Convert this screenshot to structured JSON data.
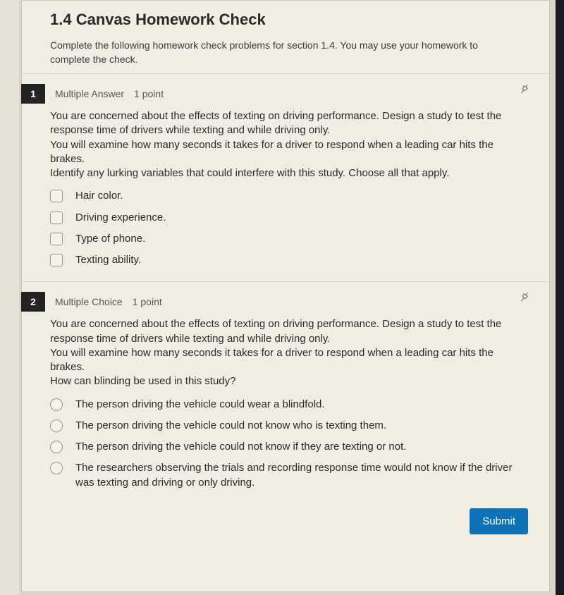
{
  "header": {
    "title": "1.4 Canvas Homework Check",
    "instructions": "Complete the following homework check problems for section 1.4. You may use your homework to complete the check."
  },
  "questions": [
    {
      "number": "1",
      "type": "Multiple Answer",
      "points": "1 point",
      "prompt": "You are concerned about the effects of texting on driving performance. Design a study to test the response time of drivers while texting and while driving only.\nYou will examine how many seconds it takes for a driver to respond when a leading car hits the brakes.\nIdentify any lurking variables that could interfere with this study.  Choose all that apply.",
      "control": "checkbox",
      "options": [
        "Hair color.",
        "Driving experience.",
        "Type of phone.",
        "Texting ability."
      ]
    },
    {
      "number": "2",
      "type": "Multiple Choice",
      "points": "1 point",
      "prompt": "You are concerned about the effects of texting on driving performance. Design a study to test the response time of drivers while texting and while driving only.\nYou will examine how many seconds it takes for a driver to respond when a leading car hits the brakes.\nHow can blinding be used in this study?",
      "control": "radio",
      "options": [
        "The person driving the vehicle could wear a blindfold.",
        "The person driving the vehicle could not know who is texting them.",
        "The person driving the vehicle could not know if they are texting or not.",
        "The researchers observing the trials and recording response time would not know if the driver was texting and driving or only driving."
      ]
    }
  ],
  "submit_label": "Submit"
}
